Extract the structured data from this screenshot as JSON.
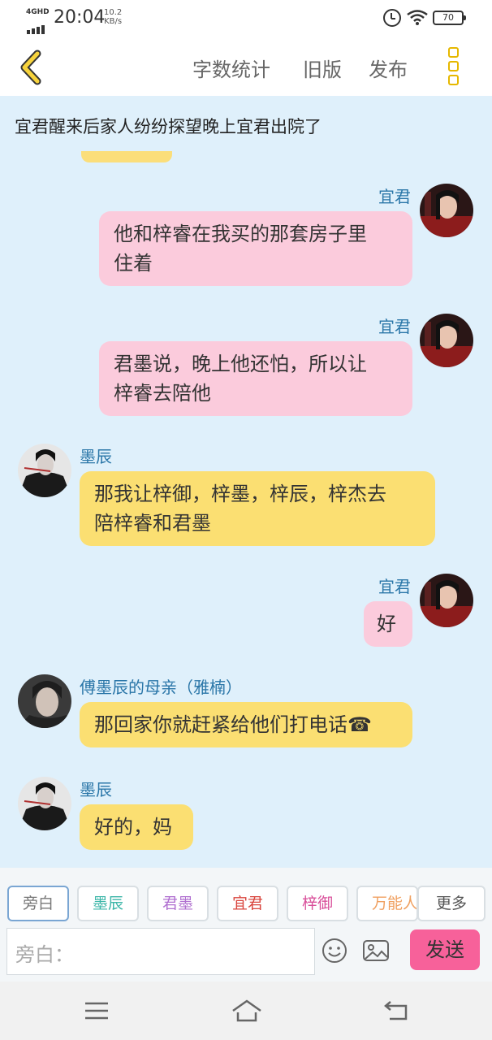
{
  "status": {
    "network": "4GHD",
    "time": "20:04",
    "speed_value": "10.2",
    "speed_unit": "KB/s",
    "battery": "70"
  },
  "toolbar": {
    "word_count": "字数统计",
    "old_version": "旧版",
    "publish": "发布"
  },
  "chat": {
    "title": "宜君醒来后家人纷纷探望晚上宜君出院了",
    "messages": [
      {
        "sender": "宜君",
        "text_lines": [
          "他和梓睿在我买的那套房子里",
          "住着"
        ]
      },
      {
        "sender": "宜君",
        "text_lines": [
          "君墨说，晚上他还怕，所以让",
          "梓睿去陪他"
        ]
      },
      {
        "sender": "墨辰",
        "text_lines": [
          "那我让梓御，梓墨，梓辰，梓杰去",
          "陪梓睿和君墨"
        ]
      },
      {
        "sender": "宜君",
        "text_lines": [
          "好"
        ]
      },
      {
        "sender": "傅墨辰的母亲（雅楠）",
        "text_lines": [
          "那回家你就赶紧给他们打电话☎"
        ]
      },
      {
        "sender": "墨辰",
        "text_lines": [
          "好的，妈"
        ]
      }
    ]
  },
  "roles": [
    {
      "label": "旁白",
      "color": "#777777"
    },
    {
      "label": "墨辰",
      "color": "#3cb6a8"
    },
    {
      "label": "君墨",
      "color": "#b06fd0"
    },
    {
      "label": "宜君",
      "color": "#d9463e"
    },
    {
      "label": "梓御",
      "color": "#d94f9a"
    },
    {
      "label": "万能人",
      "color": "#f0a060"
    }
  ],
  "more_roles": "更多",
  "input": {
    "placeholder": "旁白："
  },
  "send_label": "发送"
}
